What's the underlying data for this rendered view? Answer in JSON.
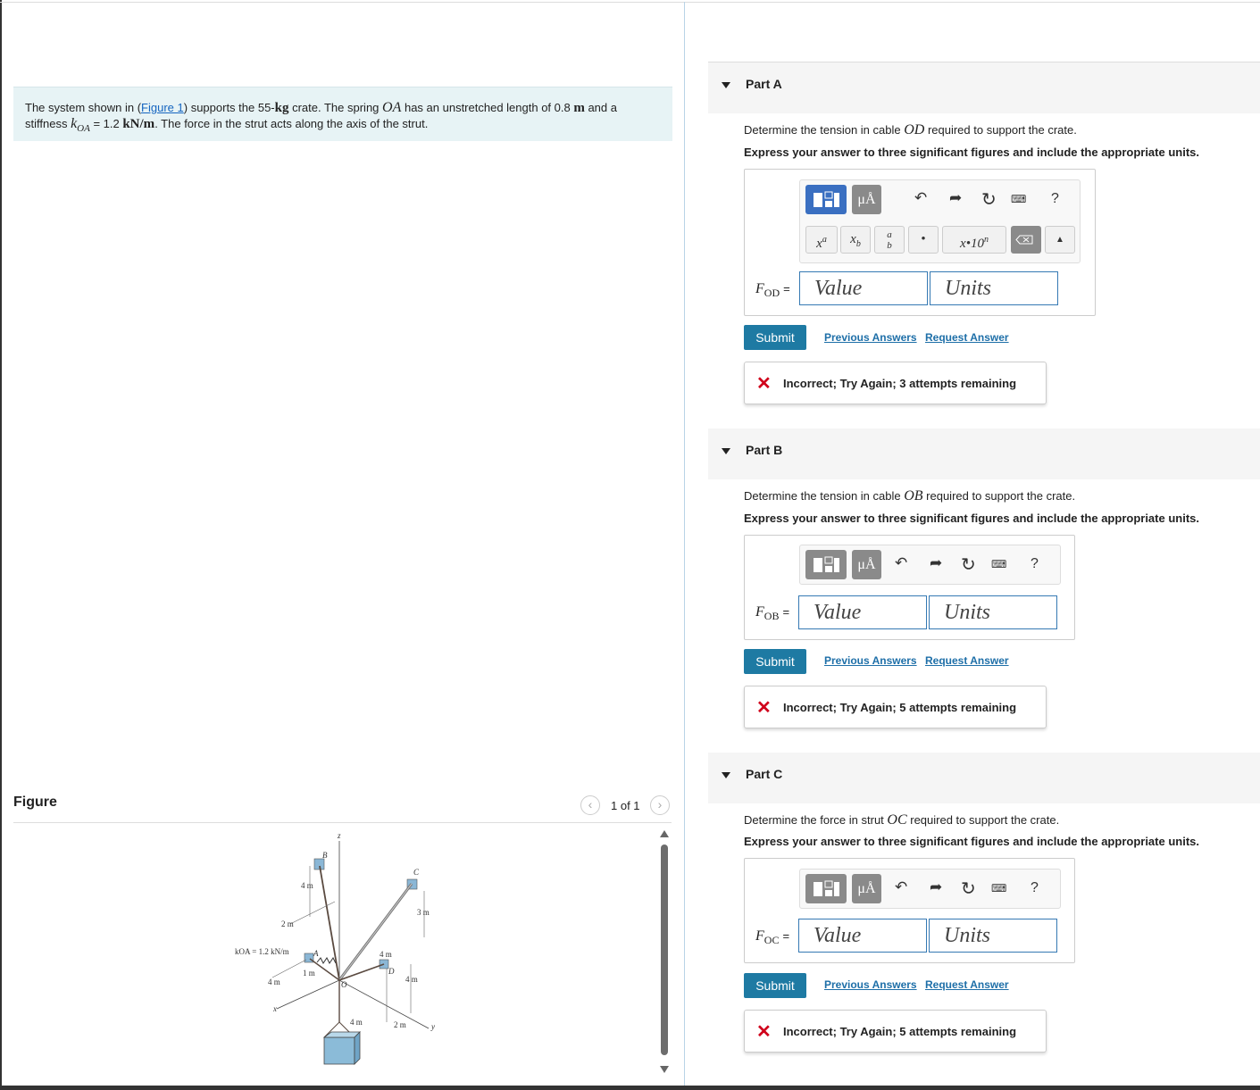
{
  "problem": {
    "p1": "The system shown in (",
    "figure_link": "Figure 1",
    "p2": ") supports the 55-",
    "unit_kg": "kg",
    "p3": " crate. The spring ",
    "var_OA": "OA",
    "p4": " has an unstretched length of 0.8 ",
    "unit_m": "m",
    "p5": " and a",
    "line2_a": "stiffness ",
    "var_k": "k",
    "var_k_sub": "OA",
    "line2_b": " = 1.2 ",
    "unit_knm": "kN/m",
    "line2_c": ". The force in the strut acts along the axis of the strut."
  },
  "figure": {
    "title": "Figure",
    "pager": "1 of 1",
    "prev_icon": "chevron-left",
    "next_icon": "chevron-right",
    "labels": {
      "z": "z",
      "x": "x",
      "y": "y",
      "A": "A",
      "B": "B",
      "C": "C",
      "D": "D",
      "O": "O",
      "koa": "kOA = 1.2 kN/m",
      "dim_4m": "4 m",
      "dim_2m": "2 m",
      "dim_1m": "1 m",
      "dim_3m": "3 m"
    }
  },
  "toolbar": {
    "templates_icon": "templates",
    "units_label": "μÅ",
    "undo_icon": "undo",
    "redo_icon": "redo",
    "reset_icon": "reset",
    "keyboard_icon": "keyboard",
    "help_label": "?",
    "sym_sup": "xa",
    "sym_sub": "xb",
    "sym_frac_num": "a",
    "sym_frac_den": "b",
    "sym_dot": "•",
    "sym_sci": "x•10n",
    "delete_icon": "backspace"
  },
  "parts": [
    {
      "label": "Part A",
      "question_a": "Determine the tension in cable ",
      "question_var": "OD",
      "question_b": " required to support the crate.",
      "instruction": "Express your answer to three significant figures and include the appropriate units.",
      "field_var": "F",
      "field_sub": "OD",
      "field_eq": "=",
      "value_placeholder": "Value",
      "units_placeholder": "Units",
      "submit": "Submit",
      "previous_answers": "Previous Answers",
      "request_answer": "Request Answer",
      "feedback": "Incorrect; Try Again; 3 attempts remaining"
    },
    {
      "label": "Part B",
      "question_a": "Determine the tension in cable ",
      "question_var": "OB",
      "question_b": " required to support the crate.",
      "instruction": "Express your answer to three significant figures and include the appropriate units.",
      "field_var": "F",
      "field_sub": "OB",
      "field_eq": "=",
      "value_placeholder": "Value",
      "units_placeholder": "Units",
      "submit": "Submit",
      "previous_answers": "Previous Answers",
      "request_answer": "Request Answer",
      "feedback": "Incorrect; Try Again; 5 attempts remaining"
    },
    {
      "label": "Part C",
      "question_a": "Determine the force in strut ",
      "question_var": "OC",
      "question_b": " required to support the crate.",
      "instruction": "Express your answer to three significant figures and include the appropriate units.",
      "field_var": "F",
      "field_sub": "OC",
      "field_eq": "=",
      "value_placeholder": "Value",
      "units_placeholder": "Units",
      "submit": "Submit",
      "previous_answers": "Previous Answers",
      "request_answer": "Request Answer",
      "feedback": "Incorrect; Try Again; 5 attempts remaining"
    }
  ],
  "colors": {
    "problem_bg": "#e7f3f5",
    "submit_bg": "#1e7aa3",
    "link": "#1e6fa8",
    "error": "#d0021b",
    "toolbar_active": "#3a6fc1"
  }
}
